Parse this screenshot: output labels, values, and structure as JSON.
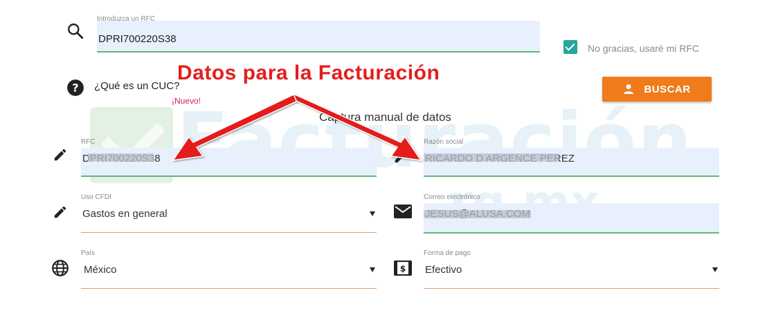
{
  "search": {
    "label": "Introduzca un RFC",
    "value": "DPRI700220S38"
  },
  "no_thanks": {
    "label": "No gracias, usaré mi RFC",
    "checked": true
  },
  "cuc": {
    "question": "¿Qué es un CUC?",
    "badge": "¡Nuevo!"
  },
  "buscar_button": {
    "label": "BUSCAR"
  },
  "annotation": {
    "headline": "Datos para la Facturación"
  },
  "manual_capture_title": "Captura manual de datos",
  "watermark": {
    "line1": "Facturación",
    "line2": "rg.mx"
  },
  "fields": {
    "rfc": {
      "label": "RFC",
      "value": "DPRI700220S38"
    },
    "razon_social": {
      "label": "Razón social",
      "value": "RICARDO D ARGENCE PEREZ"
    },
    "uso_cfdi": {
      "label": "Uso CFDI",
      "value": "Gastos en general"
    },
    "correo": {
      "label": "Correo electrónico",
      "value": "JESUS@ALUSA.COM"
    },
    "pais": {
      "label": "País",
      "value": "México"
    },
    "forma_pago": {
      "label": "Forma de pago",
      "value": "Efectivo"
    }
  },
  "icons": {
    "search": "search-icon",
    "help": "help-circle-icon",
    "person": "person-icon",
    "pencil": "pencil-icon",
    "mail": "mail-icon",
    "globe": "globe-icon",
    "money": "money-icon"
  },
  "colors": {
    "accent_orange": "#ef7b1a",
    "checkbox_teal": "#26a69a",
    "annotation_red": "#e41e1e",
    "new_badge": "#d81b60",
    "valid_green": "#5fb876",
    "autofill_blue": "#e8f0fe"
  }
}
